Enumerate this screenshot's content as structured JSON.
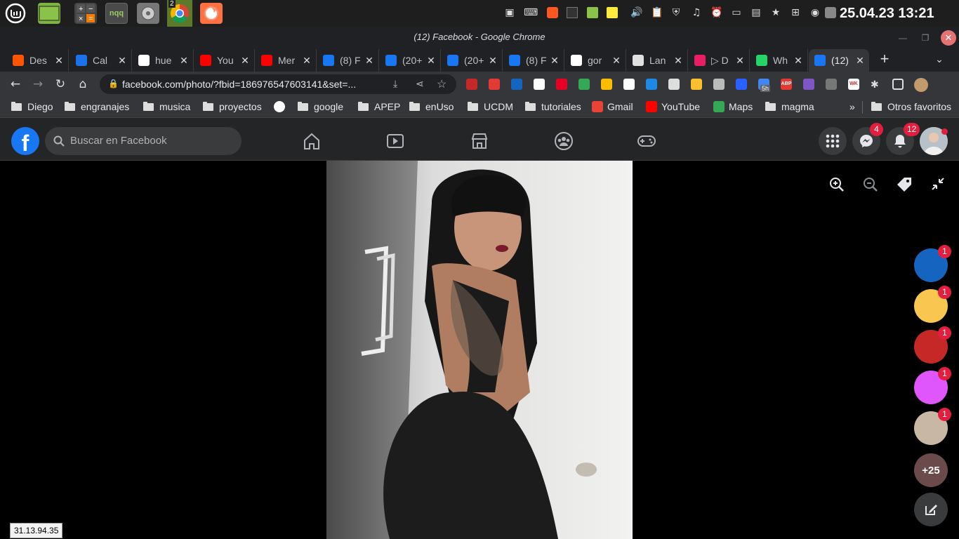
{
  "os": {
    "clock": "25.04.23 13:21",
    "launchers": [
      "mint-menu-icon",
      "terminal-icon",
      "calculator-icon",
      "nqq-editor-icon",
      "disk-usage-icon",
      "chrome-icon",
      "firefox-icon"
    ],
    "nqq_label": "nqq",
    "chrome_window_count": "2"
  },
  "window": {
    "title": "(12) Facebook - Google Chrome"
  },
  "tabs": [
    {
      "label": "Des",
      "favicon": "soundcloud-icon",
      "color": "#ff5500"
    },
    {
      "label": "Cal",
      "favicon": "calendar-icon",
      "color": "#1a73e8"
    },
    {
      "label": "hue",
      "favicon": "google-icon",
      "color": "#ffffff"
    },
    {
      "label": "You",
      "favicon": "youtube-icon",
      "color": "#ff0000"
    },
    {
      "label": "Mer",
      "favicon": "youtube-icon",
      "color": "#ff0000"
    },
    {
      "label": "(8) F",
      "favicon": "facebook-icon",
      "color": "#1877f2"
    },
    {
      "label": "(20+",
      "favicon": "facebook-icon",
      "color": "#1877f2"
    },
    {
      "label": "(20+",
      "favicon": "facebook-icon",
      "color": "#1877f2"
    },
    {
      "label": "(8) F",
      "favicon": "facebook-icon",
      "color": "#1877f2"
    },
    {
      "label": "gor",
      "favicon": "google-icon",
      "color": "#ffffff"
    },
    {
      "label": "Lan",
      "favicon": "globe-icon",
      "color": "#e0e0e0"
    },
    {
      "label": "▷ D",
      "favicon": "s-icon",
      "color": "#e91e63"
    },
    {
      "label": "Wh",
      "favicon": "whatsapp-icon",
      "color": "#25d366"
    },
    {
      "label": "(12)",
      "favicon": "facebook-icon",
      "color": "#1877f2",
      "active": true
    }
  ],
  "toolbar": {
    "url": "facebook.com/photo/?fbid=186976547603141&set=...",
    "extensions": [
      "bookmark-ext",
      "e-ext",
      "ip-ext",
      "doc-ext",
      "pinterest-ext",
      "drive-ext",
      "keep-ext",
      "back-ext",
      "css-ext",
      "ext-a",
      "ext-b",
      "ext-c",
      "zoom-ext",
      "calendar-ext",
      "adblock-ext",
      "target-ext",
      "table-ext",
      "wk-ext",
      "puzzle-icon",
      "side-panel-icon",
      "profile-avatar"
    ],
    "calendar_ext_badge": "5h",
    "abp_label": "ABP",
    "wk_label": "WK"
  },
  "bookmarks": [
    {
      "label": "Diego",
      "type": "folder"
    },
    {
      "label": "engranajes",
      "type": "folder"
    },
    {
      "label": "musica",
      "type": "folder"
    },
    {
      "label": "proyectos",
      "type": "folder"
    },
    {
      "label": "",
      "type": "google"
    },
    {
      "label": "google",
      "type": "folder"
    },
    {
      "label": "APEP",
      "type": "folder"
    },
    {
      "label": "enUso",
      "type": "folder"
    },
    {
      "label": "UCDM",
      "type": "folder"
    },
    {
      "label": "tutoriales",
      "type": "folder"
    },
    {
      "label": "Gmail",
      "type": "gmail"
    },
    {
      "label": "YouTube",
      "type": "youtube"
    },
    {
      "label": "Maps",
      "type": "maps"
    },
    {
      "label": "magma",
      "type": "folder"
    }
  ],
  "bookmarks_more": "»",
  "bookmarks_other": "Otros favoritos",
  "facebook": {
    "search_placeholder": "Buscar en Facebook",
    "messenger_badge": "4",
    "notifications_badge": "12",
    "accent": "#1877f2"
  },
  "viewer": {
    "contacts": [
      {
        "badge": "1"
      },
      {
        "badge": "1"
      },
      {
        "badge": "1"
      },
      {
        "badge": "1"
      },
      {
        "badge": "1"
      }
    ],
    "more_contacts": "+25",
    "ip_tooltip": "31.13.94.35"
  }
}
